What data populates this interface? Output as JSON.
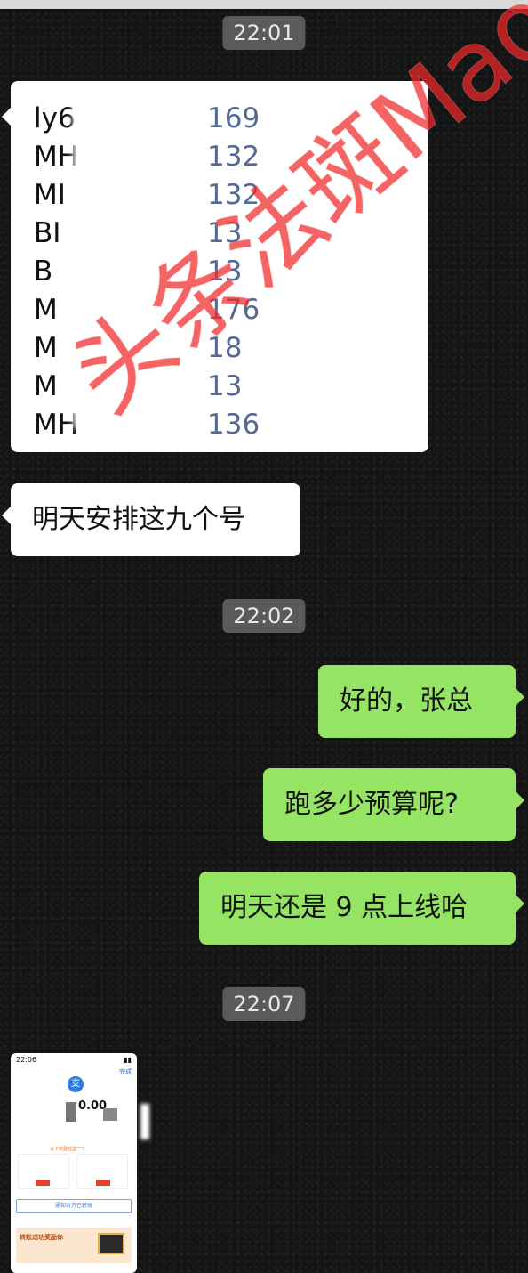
{
  "times": [
    "22:01",
    "22:02",
    "22:07"
  ],
  "contact_list": [
    {
      "name": "ly6",
      "phone": "169"
    },
    {
      "name": "MH",
      "phone": "132"
    },
    {
      "name": "MI",
      "phone": "132"
    },
    {
      "name": "BI",
      "phone": "13"
    },
    {
      "name": "B",
      "phone": "13"
    },
    {
      "name": "M",
      "phone": "176"
    },
    {
      "name": "M",
      "phone": "18"
    },
    {
      "name": "M",
      "phone": "13"
    },
    {
      "name": "MH",
      "phone": "136"
    }
  ],
  "messages": {
    "left_1": "明天安排这九个号",
    "right_1": "好的，张总",
    "right_2": "跑多少预算呢?",
    "right_3": "明天还是 9 点上线哈"
  },
  "screenshot": {
    "status_time": "22:06",
    "done": "完成",
    "avatar": "支",
    "amount": "0.00",
    "choose": "以下奖励任选一个",
    "notify": "通知对方已转账",
    "banner_title": "转账成功奖励你"
  },
  "watermark": "头条法斑Mao",
  "colors": {
    "left_bubble": "#ffffff",
    "right_bubble": "#95e463",
    "time_bg": "#5a5a5a",
    "watermark": "#f02828"
  }
}
